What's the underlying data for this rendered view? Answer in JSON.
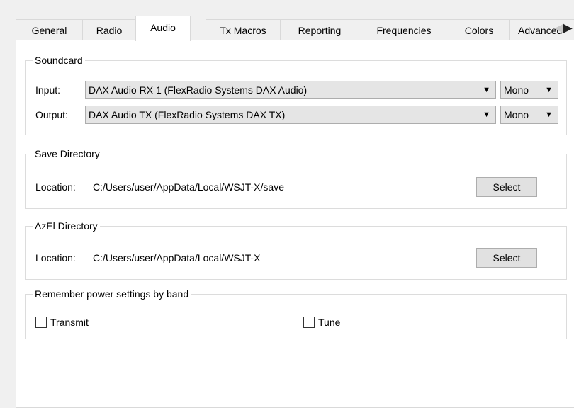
{
  "tabs": [
    {
      "label": "General",
      "active": false
    },
    {
      "label": "Radio",
      "active": false
    },
    {
      "label": "Audio",
      "active": true
    },
    {
      "label": "Tx Macros",
      "active": false
    },
    {
      "label": "Reporting",
      "active": false
    },
    {
      "label": "Frequencies",
      "active": false
    },
    {
      "label": "Colors",
      "active": false
    },
    {
      "label": "Advanced",
      "active": false
    }
  ],
  "tab_scroll_icons": [
    "scroll-left-arrow-icon",
    "scroll-right-arrow-icon"
  ],
  "soundcard": {
    "title": "Soundcard",
    "input_label": "Input:",
    "input_device": "DAX Audio RX 1 (FlexRadio Systems DAX Audio)",
    "input_channel": "Mono",
    "output_label": "Output:",
    "output_device": "DAX Audio TX (FlexRadio Systems DAX TX)",
    "output_channel": "Mono"
  },
  "save_directory": {
    "title": "Save Directory",
    "location_label": "Location:",
    "path": "C:/Users/user/AppData/Local/WSJT-X/save",
    "button": "Select"
  },
  "azel_directory": {
    "title": "AzEl Directory",
    "location_label": "Location:",
    "path": "C:/Users/user/AppData/Local/WSJT-X",
    "button": "Select"
  },
  "power_settings": {
    "title": "Remember power settings by band",
    "transmit_label": "Transmit",
    "transmit_checked": false,
    "tune_label": "Tune",
    "tune_checked": false
  },
  "colors": {
    "window_bg": "#f0f0f0",
    "pane_bg": "#ffffff",
    "control_bg": "#e5e5e5",
    "border": "#adadad"
  }
}
